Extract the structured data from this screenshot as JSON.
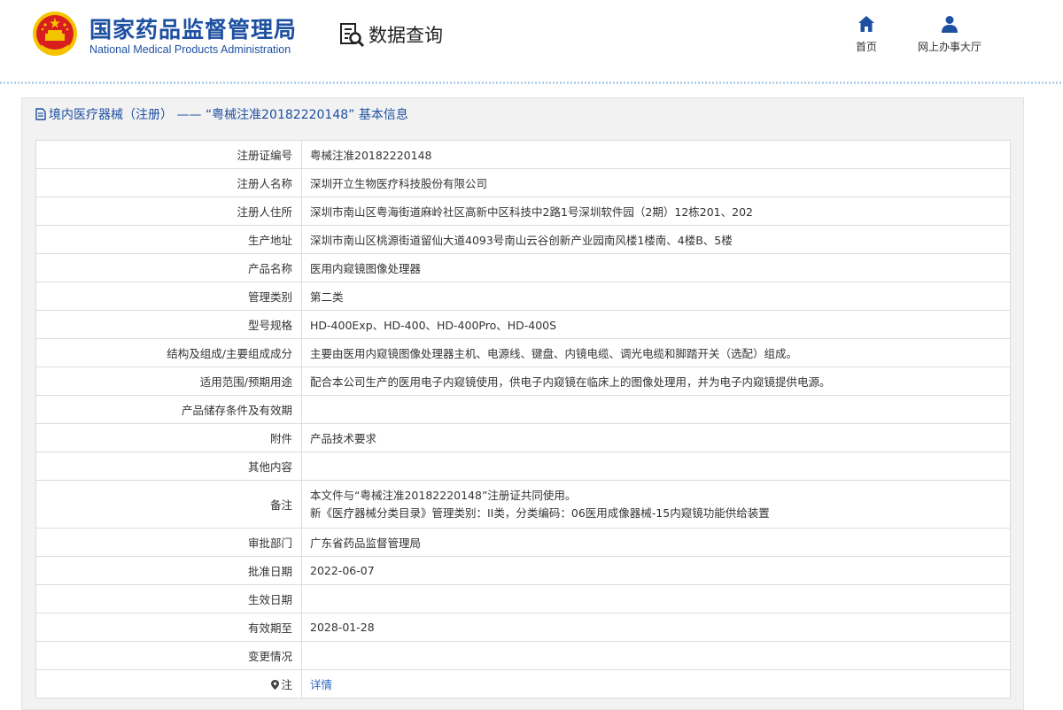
{
  "header": {
    "brand_cn": "国家药品监督管理局",
    "brand_en": "National Medical Products Administration",
    "query_label": "数据查询",
    "nav": [
      {
        "label": "首页",
        "icon": "home-icon"
      },
      {
        "label": "网上办事大厅",
        "icon": "user-icon"
      }
    ]
  },
  "panel": {
    "title": "境内医疗器械（注册） —— “粤械注准20182220148” 基本信息"
  },
  "rows": [
    {
      "label": "注册证编号",
      "value": "粤械注准20182220148"
    },
    {
      "label": "注册人名称",
      "value": "深圳开立生物医疗科技股份有限公司"
    },
    {
      "label": "注册人住所",
      "value": "深圳市南山区粤海街道麻岭社区高新中区科技中2路1号深圳软件园（2期）12栋201、202"
    },
    {
      "label": "生产地址",
      "value": "深圳市南山区桃源街道留仙大道4093号南山云谷创新产业园南风楼1楼南、4楼B、5楼"
    },
    {
      "label": "产品名称",
      "value": "医用内窥镜图像处理器"
    },
    {
      "label": "管理类别",
      "value": "第二类"
    },
    {
      "label": "型号规格",
      "value": "HD-400Exp、HD-400、HD-400Pro、HD-400S"
    },
    {
      "label": "结构及组成/主要组成成分",
      "value": "主要由医用内窥镜图像处理器主机、电源线、键盘、内镜电缆、调光电缆和脚踏开关（选配）组成。"
    },
    {
      "label": "适用范围/预期用途",
      "value": "配合本公司生产的医用电子内窥镜使用，供电子内窥镜在临床上的图像处理用，并为电子内窥镜提供电源。"
    },
    {
      "label": "产品储存条件及有效期",
      "value": ""
    },
    {
      "label": "附件",
      "value": "产品技术要求"
    },
    {
      "label": "其他内容",
      "value": ""
    },
    {
      "label": "备注",
      "value_line1": "本文件与“粤械注准20182220148”注册证共同使用。",
      "value_line2": "新《医疗器械分类目录》管理类别：II类，分类编码：06医用成像器械-15内窥镜功能供给装置"
    },
    {
      "label": "审批部门",
      "value": "广东省药品监督管理局"
    },
    {
      "label": "批准日期",
      "value": "2022-06-07"
    },
    {
      "label": "生效日期",
      "value": ""
    },
    {
      "label": "有效期至",
      "value": "2028-01-28"
    },
    {
      "label": "变更情况",
      "value": ""
    },
    {
      "label": "注",
      "value": "详情",
      "icon": "location-pin-icon"
    }
  ],
  "colors": {
    "brand_blue": "#1e50a2",
    "link_blue": "#2a66c4",
    "logo_red": "#d81e1e",
    "logo_gold": "#f5c400"
  }
}
